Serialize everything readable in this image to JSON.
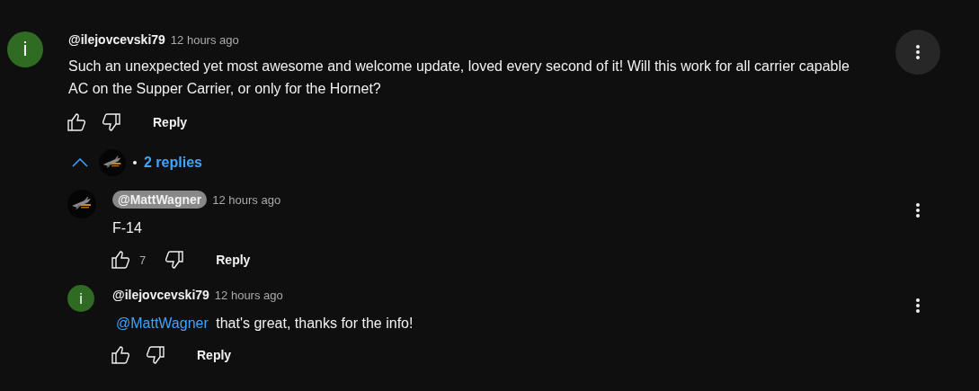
{
  "comment": {
    "author": "@ilejovcevski79",
    "time": "12 hours ago",
    "text": "Such an unexpected yet most awesome and welcome update, loved every second of it! Will this work for all carrier capable AC on the Supper Carrier, or only for the Hornet?",
    "avatar": {
      "kind": "letter",
      "letter": "i",
      "color": "#2f6b22"
    },
    "menu_hovered": true,
    "reply_label": "Reply"
  },
  "replies_toggle": {
    "expanded": true,
    "label": "2 replies"
  },
  "replies": [
    {
      "author": "@MattWagner",
      "creator": true,
      "time": "12 hours ago",
      "text": "F-14",
      "likes": "7",
      "menu_hovered": false,
      "reply_label": "Reply"
    },
    {
      "author": "@ilejovcevski79",
      "creator": false,
      "time": "12 hours ago",
      "mention": "@MattWagner",
      "text": "that's great, thanks for the info!",
      "avatar": {
        "kind": "letter",
        "letter": "i",
        "color": "#2f6b22"
      },
      "menu_hovered": false,
      "reply_label": "Reply"
    }
  ]
}
